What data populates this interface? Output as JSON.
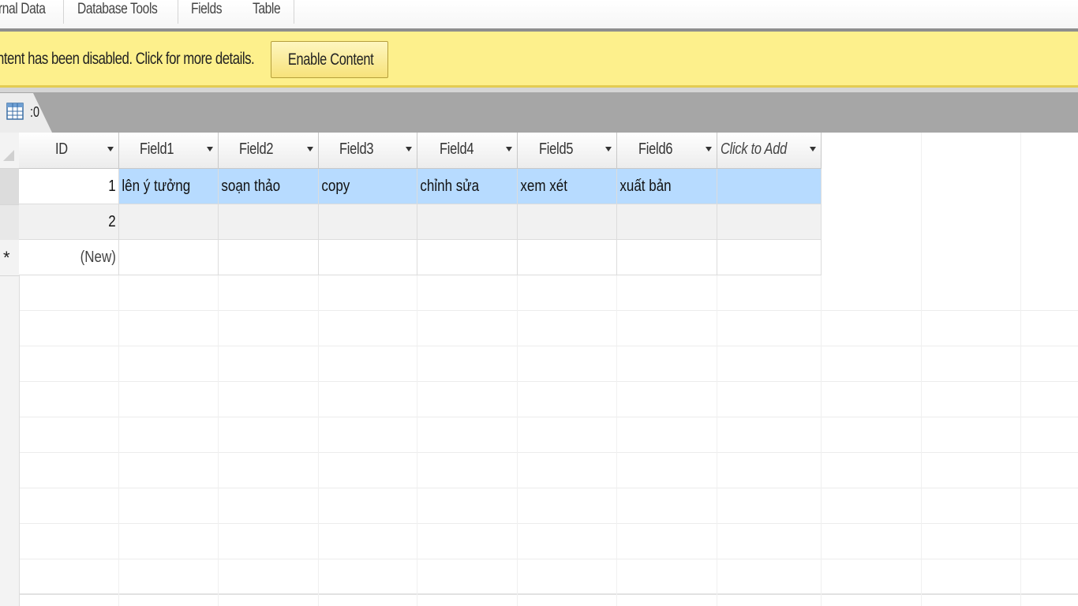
{
  "ribbon": {
    "tabs": [
      {
        "label": "rnal Data"
      },
      {
        "label": "Database Tools"
      },
      {
        "label": "Fields"
      },
      {
        "label": "Table"
      }
    ]
  },
  "message_bar": {
    "text": "ntent has been disabled. Click for more details.",
    "button_label": "Enable Content",
    "colors": {
      "background": "#fdf08c",
      "border": "#e3cc52"
    }
  },
  "document_tab": {
    "label": ":0",
    "icon": "table-icon"
  },
  "datasheet": {
    "columns": [
      {
        "label": "ID"
      },
      {
        "label": "Field1"
      },
      {
        "label": "Field2"
      },
      {
        "label": "Field3"
      },
      {
        "label": "Field4"
      },
      {
        "label": "Field5"
      },
      {
        "label": "Field6"
      },
      {
        "label": "Click to Add"
      }
    ],
    "rows": [
      {
        "id": "1",
        "cells": [
          "lên ý tưởng",
          "soạn thảo",
          "copy",
          "chỉnh sửa",
          "xem xét",
          "xuất bản",
          ""
        ]
      },
      {
        "id": "2",
        "cells": [
          "",
          "",
          "",
          "",
          "",
          "",
          ""
        ]
      }
    ],
    "new_row": {
      "marker": "*",
      "id": "(New)"
    },
    "colors": {
      "selected_row": "#b7dbff",
      "alt_row": "#f1f1f1"
    }
  }
}
